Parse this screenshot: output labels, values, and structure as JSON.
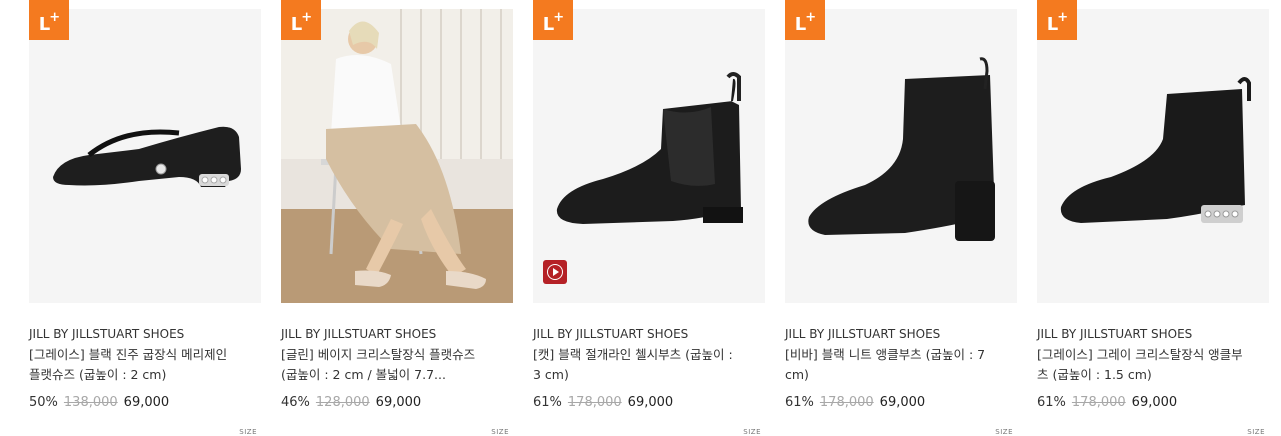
{
  "badge": {
    "label": "L",
    "plus": "+"
  },
  "size_label": "SIZE",
  "products": [
    {
      "brand": "JILL BY JILLSTUART SHOES",
      "name": "[그레이스] 블랙 진주 굽장식 메리제인 플랫슈즈 (굽높이 : 2 cm)",
      "discount": "50%",
      "original_price": "138,000",
      "price": "69,000",
      "has_video": false,
      "image_icon": "mary-jane-flat-icon"
    },
    {
      "brand": "JILL BY JILLSTUART SHOES",
      "name": "[글린] 베이지 크리스탈장식 플랫슈즈 (굽높이 : 2 cm / 볼넓이 7.7...",
      "discount": "46%",
      "original_price": "128,000",
      "price": "69,000",
      "has_video": false,
      "image_icon": "model-photo-icon"
    },
    {
      "brand": "JILL BY JILLSTUART SHOES",
      "name": "[캣] 블랙 절개라인 첼시부츠 (굽높이 : 3 cm)",
      "discount": "61%",
      "original_price": "178,000",
      "price": "69,000",
      "has_video": true,
      "image_icon": "chelsea-boot-icon"
    },
    {
      "brand": "JILL BY JILLSTUART SHOES",
      "name": "[비바] 블랙 니트 앵클부츠 (굽높이 : 7 cm)",
      "discount": "61%",
      "original_price": "178,000",
      "price": "69,000",
      "has_video": false,
      "image_icon": "knit-boot-icon"
    },
    {
      "brand": "JILL BY JILLSTUART SHOES",
      "name": "[그레이스] 그레이 크리스탈장식 앵클부츠 (굽높이 : 1.5 cm)",
      "discount": "61%",
      "original_price": "178,000",
      "price": "69,000",
      "has_video": false,
      "image_icon": "ankle-boot-icon"
    }
  ]
}
